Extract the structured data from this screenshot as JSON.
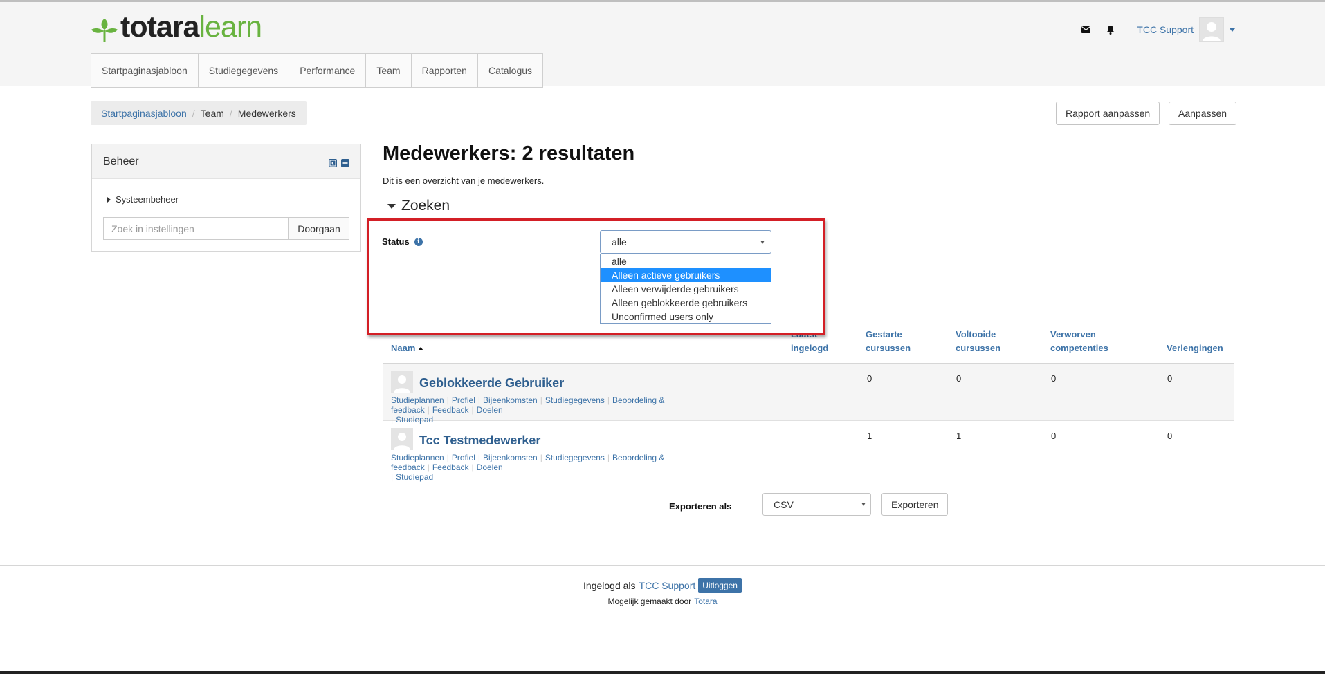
{
  "header": {
    "logo_bold": "totara",
    "logo_light": "learn",
    "user_name": "TCC Support",
    "icons": [
      "envelope-icon",
      "bell-icon",
      "avatar",
      "caret-down-icon"
    ]
  },
  "nav": {
    "tabs": [
      "Startpaginasjabloon",
      "Studiegegevens",
      "Performance",
      "Team",
      "Rapporten",
      "Catalogus"
    ]
  },
  "breadcrumb": {
    "items": [
      "Startpaginasjabloon",
      "Team",
      "Medewerkers"
    ]
  },
  "actions": {
    "rapport_aanpassen": "Rapport aanpassen",
    "aanpassen": "Aanpassen"
  },
  "block": {
    "title": "Beheer",
    "tree_item": "Systeembeheer",
    "search_placeholder": "Zoek in instellingen",
    "go_label": "Doorgaan"
  },
  "main": {
    "title": "Medewerkers: 2 resultaten",
    "intro": "Dit is een overzicht van je medewerkers.",
    "search_legend": "Zoeken"
  },
  "filter": {
    "status_label": "Status",
    "selected": "alle",
    "options": [
      "alle",
      "Alleen actieve gebruikers",
      "Alleen verwijderde gebruikers",
      "Alleen geblokkeerde gebruikers",
      "Unconfirmed users only"
    ],
    "highlighted_option": "Alleen actieve gebruikers"
  },
  "table": {
    "headers": {
      "naam": "Naam",
      "laatst_1": "Laatst",
      "laatst_2": "ingelogd",
      "gestarte_1": "Gestarte",
      "gestarte_2": "cursussen",
      "voltooide_1": "Voltooide",
      "voltooide_2": "cursussen",
      "verworven_1": "Verworven",
      "verworven_2": "competenties",
      "verlengingen": "Verlengingen"
    },
    "row_links": [
      "Studieplannen",
      "Profiel",
      "Bijeenkomsten",
      "Studiegegevens",
      "Beoordeling & feedback",
      "Feedback",
      "Doelen",
      "Studiepad"
    ],
    "rows": [
      {
        "name": "Geblokkeerde Gebruiker",
        "gestarte": "0",
        "voltooide": "0",
        "verworven": "0",
        "verlengingen": "0"
      },
      {
        "name": "Tcc Testmedewerker",
        "gestarte": "1",
        "voltooide": "1",
        "verworven": "0",
        "verlengingen": "0"
      }
    ]
  },
  "export": {
    "label": "Exporteren als",
    "format": "CSV",
    "button": "Exporteren"
  },
  "footer": {
    "logged_in_as": "Ingelogd als",
    "user": "TCC Support",
    "logout": "Uitloggen",
    "powered_by": "Mogelijk gemaakt door",
    "powered_link": "Totara"
  },
  "colors": {
    "link": "#3d73a8",
    "brand_green": "#69b340",
    "highlight_red": "#d31f26",
    "selected_option": "#1e90ff"
  }
}
